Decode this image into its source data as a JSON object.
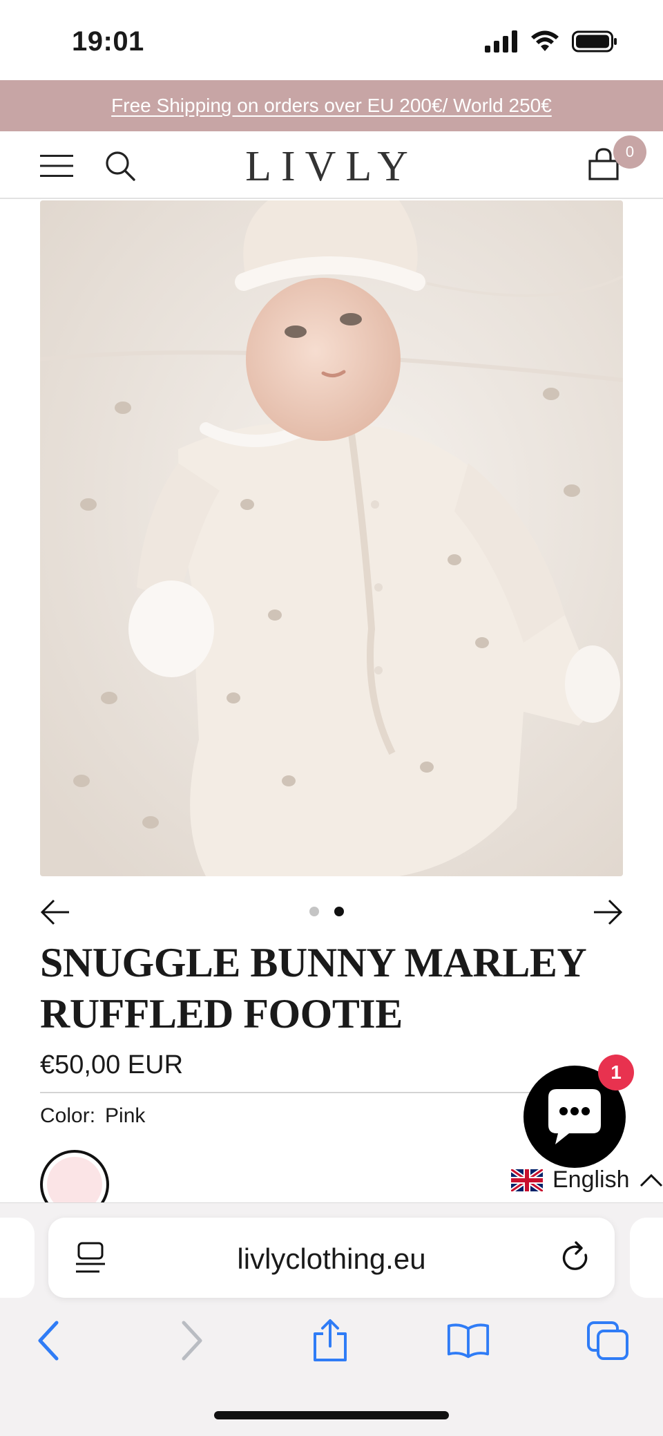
{
  "status_bar": {
    "time": "19:01"
  },
  "announcement": {
    "text": "Free Shipping on orders over EU 200€/ World 250€"
  },
  "header": {
    "logo": "LIVLY",
    "cart_count": "0"
  },
  "gallery": {
    "dots": 2,
    "active_dot": 2
  },
  "product": {
    "title_line1": "SNUGGLE BUNNY MARLEY",
    "title_line2": "RUFFLED FOOTIE",
    "price": "€50,00 EUR",
    "color_label": "Color:",
    "color_value": "Pink",
    "swatch_color": "#fbe4e6"
  },
  "chat": {
    "badge": "1"
  },
  "language": {
    "label": "English"
  },
  "browser": {
    "url": "livlyclothing.eu"
  },
  "colors": {
    "accent": "#c7a5a5",
    "chat_badge": "#e8324f",
    "ios_blue": "#2f7cf6"
  }
}
